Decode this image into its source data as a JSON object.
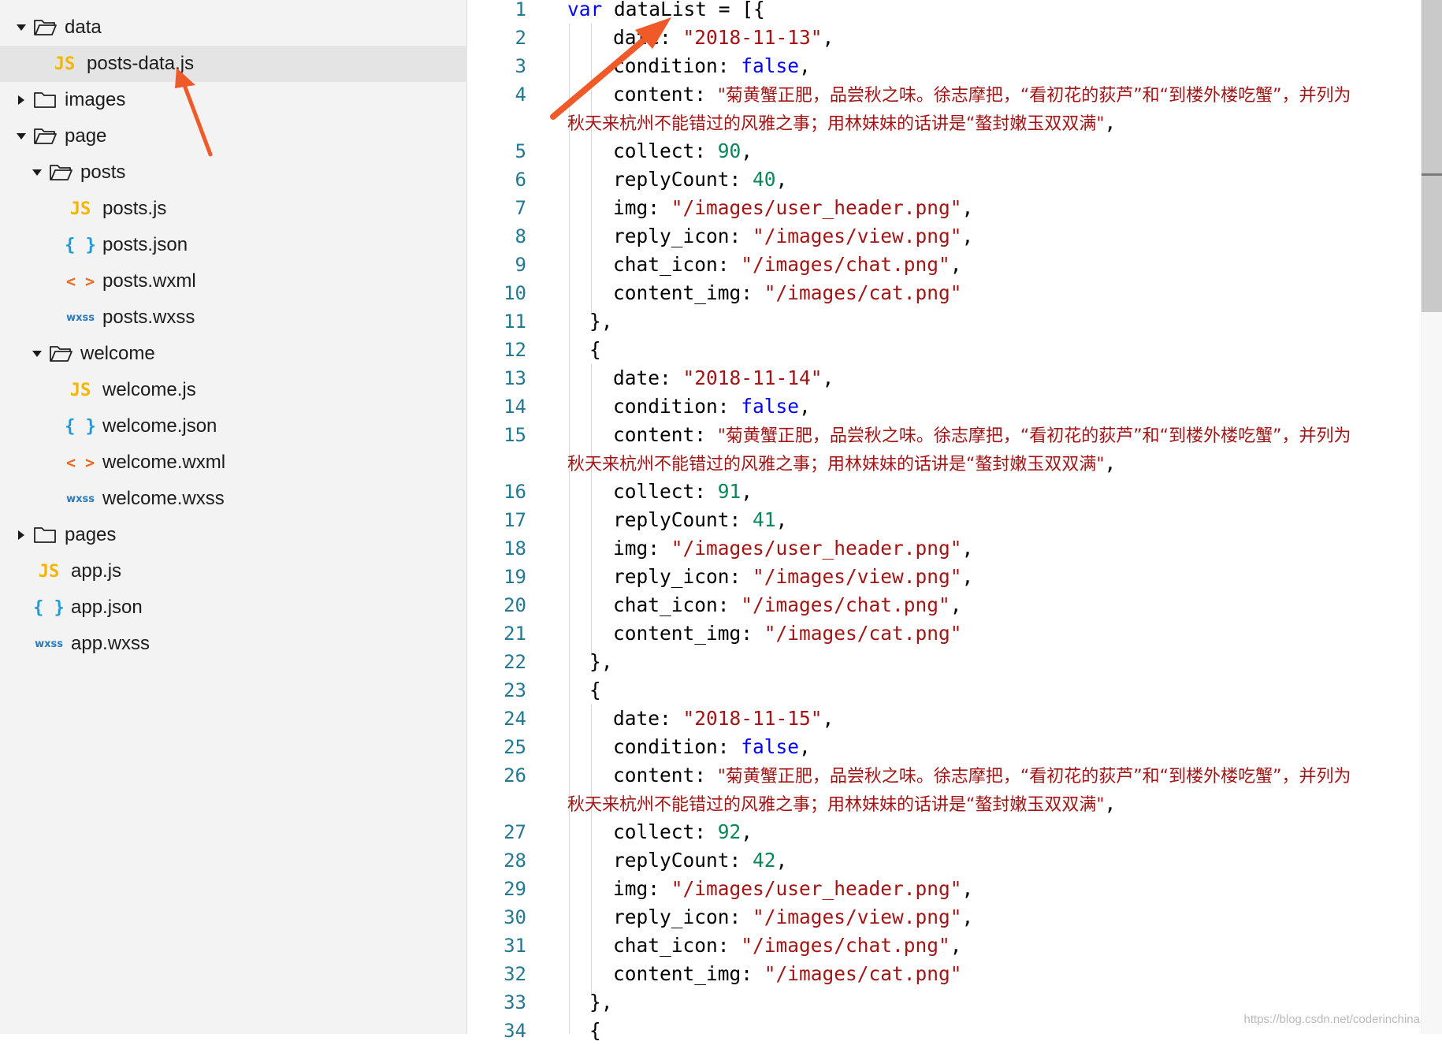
{
  "sidebar": {
    "items": [
      {
        "label": "data",
        "type": "folder",
        "state": "expanded",
        "depth": 0
      },
      {
        "label": "posts-data.js",
        "type": "js",
        "depth": 1,
        "selected": true
      },
      {
        "label": "images",
        "type": "folder",
        "state": "collapsed",
        "depth": 0
      },
      {
        "label": "page",
        "type": "folder",
        "state": "expanded",
        "depth": 0
      },
      {
        "label": "posts",
        "type": "folder",
        "state": "expanded",
        "depth": 1
      },
      {
        "label": "posts.js",
        "type": "js",
        "depth": 2
      },
      {
        "label": "posts.json",
        "type": "json",
        "depth": 2
      },
      {
        "label": "posts.wxml",
        "type": "wxml",
        "depth": 2
      },
      {
        "label": "posts.wxss",
        "type": "wxss",
        "depth": 2
      },
      {
        "label": "welcome",
        "type": "folder",
        "state": "expanded",
        "depth": 1
      },
      {
        "label": "welcome.js",
        "type": "js",
        "depth": 2
      },
      {
        "label": "welcome.json",
        "type": "json",
        "depth": 2
      },
      {
        "label": "welcome.wxml",
        "type": "wxml",
        "depth": 2
      },
      {
        "label": "welcome.wxss",
        "type": "wxss",
        "depth": 2
      },
      {
        "label": "pages",
        "type": "folder",
        "state": "collapsed",
        "depth": 0
      },
      {
        "label": "app.js",
        "type": "js",
        "depth": 1
      },
      {
        "label": "app.json",
        "type": "json",
        "depth": 1
      },
      {
        "label": "app.wxss",
        "type": "wxss",
        "depth": 1
      }
    ],
    "badges": {
      "js": "JS",
      "json": "{ }",
      "wxml": "< >",
      "wxss": "wxss"
    }
  },
  "editor": {
    "line_numbers": [
      "1",
      "2",
      "3",
      "4",
      "5",
      "6",
      "7",
      "8",
      "9",
      "10",
      "11",
      "12",
      "13",
      "14",
      "15",
      "16",
      "17",
      "18",
      "19",
      "20",
      "21",
      "22",
      "23",
      "24",
      "25",
      "26",
      "27",
      "28",
      "29",
      "30",
      "31",
      "32",
      "33",
      "34"
    ],
    "code": {
      "l1": {
        "kw": "var",
        "rest": " dataList = [{"
      },
      "l2": {
        "key": "date: ",
        "str": "\"2018-11-13\"",
        "end": ","
      },
      "l3": {
        "key": "condition: ",
        "kw": "false",
        "end": ","
      },
      "l4": {
        "key": "content: ",
        "str": "\"菊黄蟹正肥，品尝秋之味。徐志摩把，“看初花的荻芦”和“到楼外楼吃蟹”，并列为"
      },
      "l4b": {
        "str": "秋天来杭州不能错过的风雅之事；用林妹妹的话讲是“螯封嫩玉双双满\"",
        "end": ","
      },
      "l5": {
        "key": "collect: ",
        "num": "90",
        "end": ","
      },
      "l6": {
        "key": "replyCount: ",
        "num": "40",
        "end": ","
      },
      "l7": {
        "key": "img: ",
        "str": "\"/images/user_header.png\"",
        "end": ","
      },
      "l8": {
        "key": "reply_icon: ",
        "str": "\"/images/view.png\"",
        "end": ","
      },
      "l9": {
        "key": "chat_icon: ",
        "str": "\"/images/chat.png\"",
        "end": ","
      },
      "l10": {
        "key": "content_img: ",
        "str": "\"/images/cat.png\""
      },
      "l11": {
        "text": "},"
      },
      "l12": {
        "text": "{"
      },
      "l13": {
        "key": "date: ",
        "str": "\"2018-11-14\"",
        "end": ","
      },
      "l14": {
        "key": "condition: ",
        "kw": "false",
        "end": ","
      },
      "l15": {
        "key": "content: ",
        "str": "\"菊黄蟹正肥，品尝秋之味。徐志摩把，“看初花的荻芦”和“到楼外楼吃蟹”，并列为"
      },
      "l15b": {
        "str": "秋天来杭州不能错过的风雅之事；用林妹妹的话讲是“螯封嫩玉双双满\"",
        "end": ","
      },
      "l16": {
        "key": "collect: ",
        "num": "91",
        "end": ","
      },
      "l17": {
        "key": "replyCount: ",
        "num": "41",
        "end": ","
      },
      "l18": {
        "key": "img: ",
        "str": "\"/images/user_header.png\"",
        "end": ","
      },
      "l19": {
        "key": "reply_icon: ",
        "str": "\"/images/view.png\"",
        "end": ","
      },
      "l20": {
        "key": "chat_icon: ",
        "str": "\"/images/chat.png\"",
        "end": ","
      },
      "l21": {
        "key": "content_img: ",
        "str": "\"/images/cat.png\""
      },
      "l22": {
        "text": "},"
      },
      "l23": {
        "text": "{"
      },
      "l24": {
        "key": "date: ",
        "str": "\"2018-11-15\"",
        "end": ","
      },
      "l25": {
        "key": "condition: ",
        "kw": "false",
        "end": ","
      },
      "l26": {
        "key": "content: ",
        "str": "\"菊黄蟹正肥，品尝秋之味。徐志摩把，“看初花的荻芦”和“到楼外楼吃蟹”，并列为"
      },
      "l26b": {
        "str": "秋天来杭州不能错过的风雅之事；用林妹妹的话讲是“螯封嫩玉双双满\"",
        "end": ","
      },
      "l27": {
        "key": "collect: ",
        "num": "92",
        "end": ","
      },
      "l28": {
        "key": "replyCount: ",
        "num": "42",
        "end": ","
      },
      "l29": {
        "key": "img: ",
        "str": "\"/images/user_header.png\"",
        "end": ","
      },
      "l30": {
        "key": "reply_icon: ",
        "str": "\"/images/view.png\"",
        "end": ","
      },
      "l31": {
        "key": "chat_icon: ",
        "str": "\"/images/chat.png\"",
        "end": ","
      },
      "l32": {
        "key": "content_img: ",
        "str": "\"/images/cat.png\""
      },
      "l33": {
        "text": "},"
      },
      "l34": {
        "text": "{"
      }
    }
  },
  "annotations": {
    "arrow_color": "#f05a28"
  },
  "watermark": "https://blog.csdn.net/coderinchina",
  "colors": {
    "keyword": "#0000ff",
    "string": "#a31515",
    "number": "#098658",
    "line_number": "#237893"
  }
}
